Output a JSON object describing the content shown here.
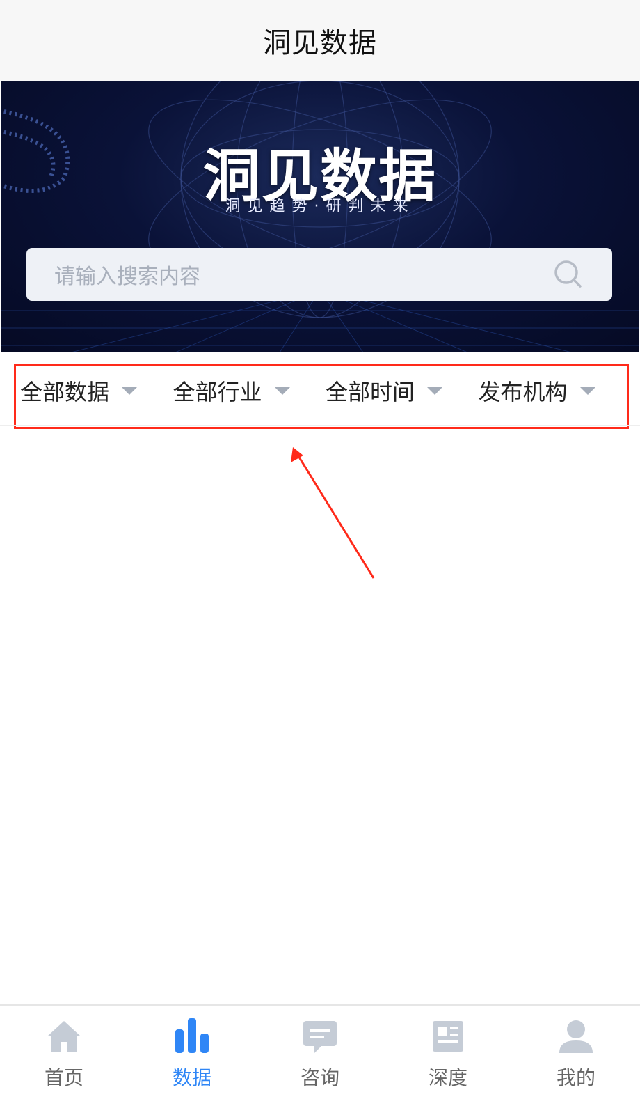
{
  "header": {
    "title": "洞见数据"
  },
  "banner": {
    "brand": "洞见数据",
    "slogan": "洞见趋势·研判未来"
  },
  "search": {
    "placeholder": "请输入搜索内容",
    "icon": "search-icon"
  },
  "filters": [
    {
      "label": "全部数据",
      "icon": "caret-down-icon"
    },
    {
      "label": "全部行业",
      "icon": "caret-down-icon"
    },
    {
      "label": "全部时间",
      "icon": "caret-down-icon"
    },
    {
      "label": "发布机构",
      "icon": "caret-down-icon"
    }
  ],
  "tabbar": {
    "items": [
      {
        "label": "首页",
        "icon": "home-icon",
        "active": false
      },
      {
        "label": "数据",
        "icon": "bar-chart-icon",
        "active": true
      },
      {
        "label": "咨询",
        "icon": "chat-icon",
        "active": false
      },
      {
        "label": "深度",
        "icon": "article-icon",
        "active": false
      },
      {
        "label": "我的",
        "icon": "user-icon",
        "active": false
      }
    ]
  },
  "colors": {
    "accent": "#2f86f6",
    "inactive_icon": "#c5ccd6",
    "annotation": "#ff2a1a",
    "banner_bg": "#0a1238"
  }
}
